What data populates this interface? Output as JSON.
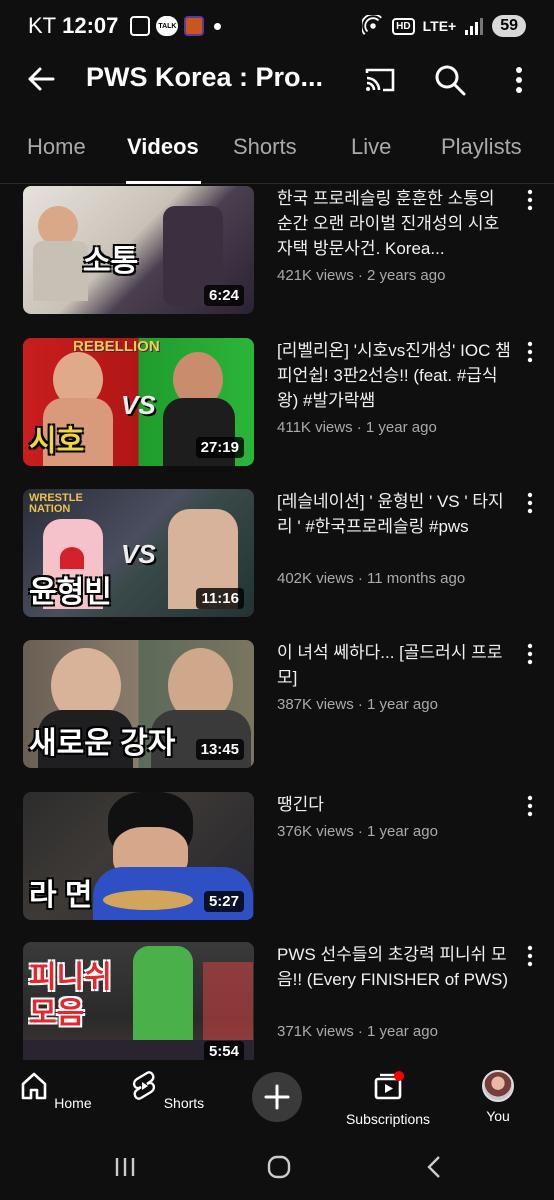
{
  "status_bar": {
    "carrier": "KT",
    "time": "12:07",
    "talk_label": "TALK",
    "hd_label": "HD",
    "network": "LTE+",
    "battery": "59"
  },
  "header": {
    "title": "PWS Korea : Pro..."
  },
  "tabs": [
    {
      "label": "Home"
    },
    {
      "label": "Videos"
    },
    {
      "label": "Shorts"
    },
    {
      "label": "Live"
    },
    {
      "label": "Playlists"
    }
  ],
  "videos": [
    {
      "title": "한국 프로레슬링 훈훈한 소통의 순간 오랜 라이벌 진개성의 시호 자택 방문사건. Korea...",
      "meta": "421K views · 2 years ago",
      "duration": "6:24",
      "thumb_text": "소통"
    },
    {
      "title": "[리벨리온] '시호vs진개성' IOC 챔피언쉽! 3판2선승!! (feat. #급식왕) #발가락쌤",
      "meta": "411K views · 1 year ago",
      "duration": "27:19",
      "thumb_text": "시호",
      "thumb_banner": "REBELLION"
    },
    {
      "title": "[레슬네이션] ' 윤형빈 ' VS ' 타지리 ' #한국프로레슬링 #pws",
      "meta": "402K views · 11 months ago",
      "duration": "11:16",
      "thumb_text": "윤형빈",
      "thumb_banner": "WRESTLE NATION"
    },
    {
      "title": "이 녀석 쎄하다... [골드러시 프로모]",
      "meta": "387K views · 1 year ago",
      "duration": "13:45",
      "thumb_text": "새로운 강자"
    },
    {
      "title": "땡긴다",
      "meta": "376K views · 1 year ago",
      "duration": "5:27",
      "thumb_text": "라 면"
    },
    {
      "title": "PWS 선수들의 초강력 피니쉬 모음!! (Every FINISHER of PWS)",
      "meta": "371K views · 1 year ago",
      "duration": "5:54",
      "thumb_text": "피니쉬 모음"
    }
  ],
  "bottom_nav": [
    {
      "label": "Home"
    },
    {
      "label": "Shorts"
    },
    {
      "label": "Subscriptions"
    },
    {
      "label": "You"
    }
  ],
  "colors": {
    "background": "#0f0f0f",
    "text_primary": "#f1f1f1",
    "text_secondary": "#aaaaaa",
    "notification_dot": "#ff0000"
  }
}
